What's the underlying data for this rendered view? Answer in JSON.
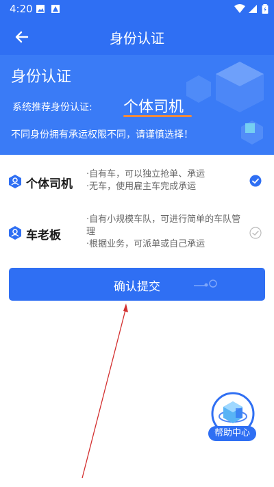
{
  "status_bar": {
    "time": "4:20"
  },
  "app_bar": {
    "title": "身份认证"
  },
  "banner": {
    "heading": "身份认证",
    "recommend_label": "系统推荐身份认证:",
    "recommend_value": "个体司机",
    "note": "不同身份拥有承运权限不同，请谨慎选择！"
  },
  "roles": [
    {
      "name": "个体司机",
      "desc": [
        "·自有车，可以独立抢单、承运",
        "·无车，使用雇主车完成承运"
      ],
      "selected": true
    },
    {
      "name": "车老板",
      "desc": [
        "·自有小规模车队，可进行简单的车队管理",
        "·根据业务，可派单或自己承运"
      ],
      "selected": false
    }
  ],
  "submit": {
    "label": "确认提交"
  },
  "help": {
    "label": "帮助中心"
  },
  "colors": {
    "primary": "#2f6ff3",
    "accent_underline": "#f08a3c",
    "arrow": "#d32f2f"
  }
}
